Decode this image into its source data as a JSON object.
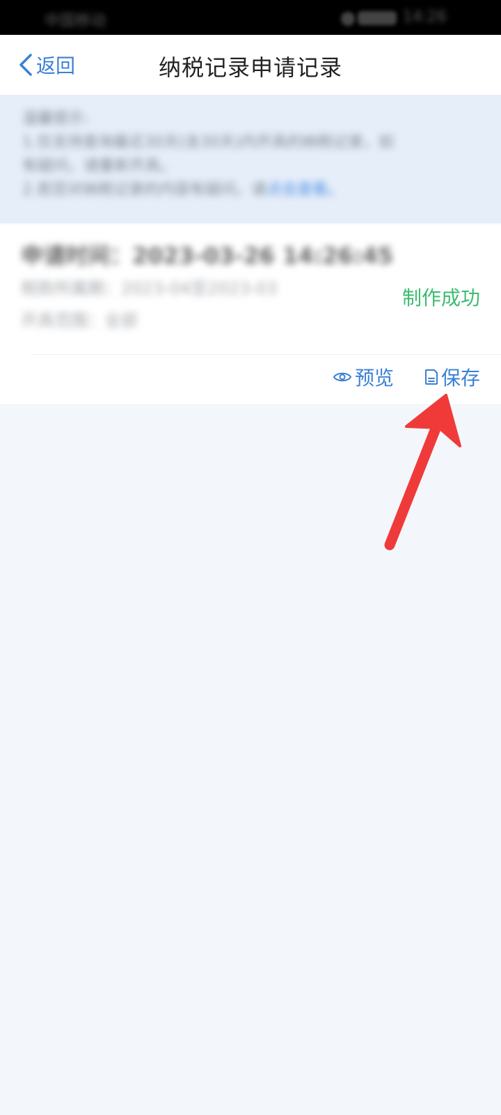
{
  "status_bar": {
    "carrier": "中国移动",
    "time": "14:26"
  },
  "nav": {
    "back_label": "返回",
    "title": "纳税记录申请记录"
  },
  "tips": {
    "line1": "温馨提示:",
    "line2": "1.仅支持查询最近30天(含30天)内开具的纳税记录，如",
    "line3": "有疑问，请重新开具。",
    "line4_text": "2.若您对纳税记录的内容有疑问，请",
    "line4_link": "点击查看。"
  },
  "record": {
    "apply_time": "申请时间：2023-03-26 14:26:45",
    "tax_period": "税款所属期：2023-04至2023-03",
    "issue_scope": "开具范围：全部",
    "status": "制作成功",
    "preview_label": "预览",
    "save_label": "保存"
  },
  "colors": {
    "accent": "#3a7fd5",
    "success": "#3dbb70",
    "annotation": "#f03a3a",
    "background": "#f3f6fa"
  }
}
